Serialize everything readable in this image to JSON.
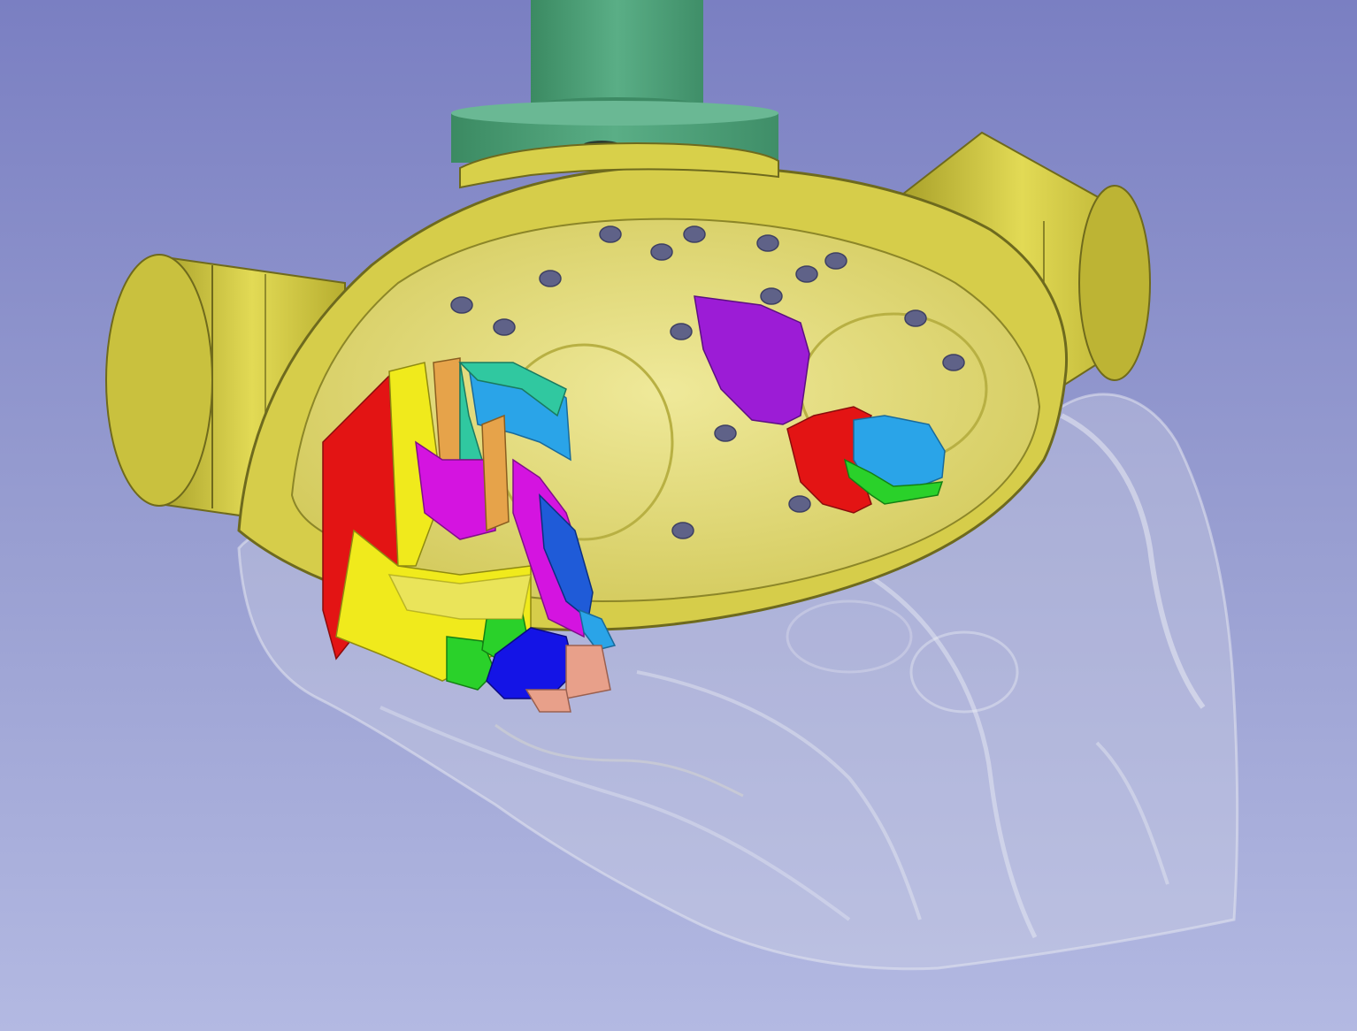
{
  "viewport": {
    "background_top": "#7a7fc2",
    "background_bottom": "#b3b9e2"
  },
  "scene": {
    "models": [
      {
        "name": "guide-cylinder",
        "color": "#4f9e78"
      },
      {
        "name": "skull-guide-frame",
        "color": "#d8d04a"
      },
      {
        "name": "skull-surface",
        "color": "#c9cde0",
        "opacity": 0.35
      },
      {
        "name": "electrode-contacts",
        "color": "#5f6288"
      }
    ],
    "segment_colors": [
      "#e31414",
      "#f0ea1c",
      "#d414e0",
      "#2aa4e8",
      "#2ad12a",
      "#1414e6",
      "#e6a34a",
      "#e8a08a",
      "#30c8a0",
      "#9c1cd6"
    ]
  }
}
